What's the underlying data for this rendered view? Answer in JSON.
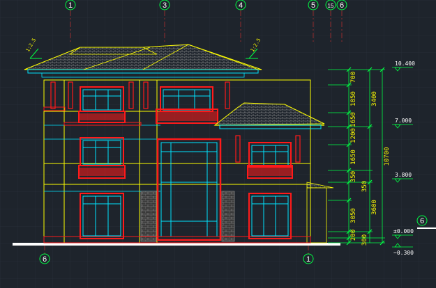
{
  "canvas": {
    "background": "#1e242c",
    "grid_color": "#2a313b"
  },
  "colors": {
    "yellow": "#ffff00",
    "cyan": "#00e5ff",
    "red": "#ff1a1a",
    "white": "#ffffff",
    "green": "#00ff44",
    "grey": "#a0a0a0",
    "roof": "#c8c8c8"
  },
  "axis_labels_top": [
    "1",
    "3",
    "4",
    "5",
    "15",
    "6"
  ],
  "axis_labels_bottom": [
    "6",
    "1"
  ],
  "axis_label_right": "6",
  "elevation_marks": [
    "10.400",
    "7.000",
    "3.800",
    "±0.000",
    "−0.300"
  ],
  "dimensions_inner": [
    "700",
    "1850",
    "1650",
    "1200",
    "1650",
    "350",
    "3050",
    "200",
    "300"
  ],
  "dimensions_middle": [
    "3400",
    "3600",
    "350"
  ],
  "dimension_total": "10700",
  "hatch_labels": [
    "1:2.5",
    "1:2.5"
  ]
}
